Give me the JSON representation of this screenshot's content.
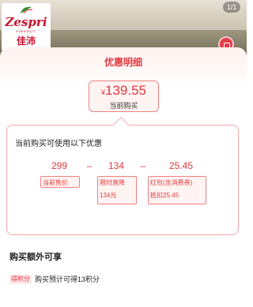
{
  "background": {
    "brand_word": "Zespri",
    "brand_sub": "KIWIFRUIT",
    "brand_cn": "佳沛",
    "page_indicator": "1/1"
  },
  "sheet": {
    "title": "优惠明细",
    "current_price": {
      "currency": "¥",
      "value": "139.55",
      "label": "当前购买"
    },
    "calc": {
      "heading": "当前购买可使用以下优惠",
      "items": [
        {
          "value": "299",
          "label": "当前售价",
          "detail": ""
        },
        {
          "value": "134",
          "label": "限时直降",
          "detail": "134元"
        },
        {
          "value": "25.45",
          "label": "红包(含消费券)",
          "detail": "抵扣25.45"
        }
      ],
      "operators": [
        "–",
        "–"
      ]
    },
    "extra": {
      "heading": "购买额外可享",
      "points_badge": "得积分",
      "points_text": "购买预计可得13积分"
    }
  },
  "colors": {
    "accent": "#e0393e",
    "border": "#f08080",
    "tag_bg": "#fff4f2"
  }
}
